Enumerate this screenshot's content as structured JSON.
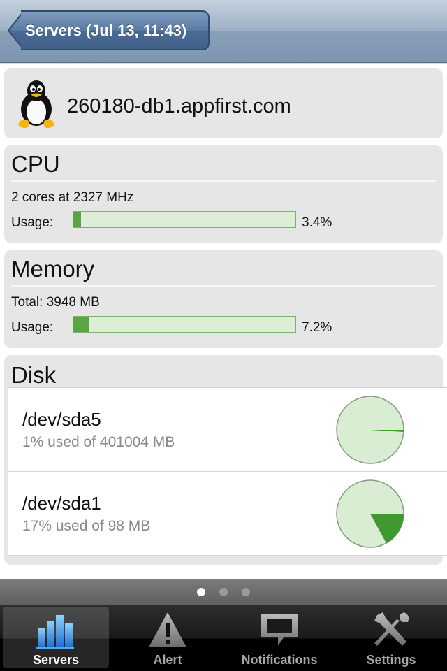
{
  "navbar": {
    "back_label": "Servers (Jul 13, 11:43)"
  },
  "host": {
    "name": "260180-db1.appfirst.com",
    "os_icon": "linux-tux-icon"
  },
  "cpu": {
    "title": "CPU",
    "info": "2 cores at 2327 MHz",
    "usage_label": "Usage:",
    "usage_value": "3.4%",
    "usage_percent": 3.4
  },
  "memory": {
    "title": "Memory",
    "info": "Total: 3948 MB",
    "usage_label": "Usage:",
    "usage_value": "7.2%",
    "usage_percent": 7.2
  },
  "disk": {
    "title": "Disk",
    "items": [
      {
        "name": "/dev/sda5",
        "usage": "1% used of 401004 MB",
        "used_percent": 1
      },
      {
        "name": "/dev/sda1",
        "usage": "17% used of 98 MB",
        "used_percent": 17
      }
    ]
  },
  "pager": {
    "pages": 3,
    "current": 0
  },
  "tabs": [
    {
      "label": "Servers",
      "icon": "servers-chart-icon",
      "selected": true
    },
    {
      "label": "Alert",
      "icon": "alert-warning-icon",
      "selected": false
    },
    {
      "label": "Notifications",
      "icon": "notifications-speech-icon",
      "selected": false
    },
    {
      "label": "Settings",
      "icon": "settings-tools-icon",
      "selected": false
    }
  ],
  "colors": {
    "bar_fill": "#5aa543",
    "bar_track": "#dcefd6",
    "pie_used": "#3f9a2e",
    "pie_free": "#d8edd2"
  }
}
